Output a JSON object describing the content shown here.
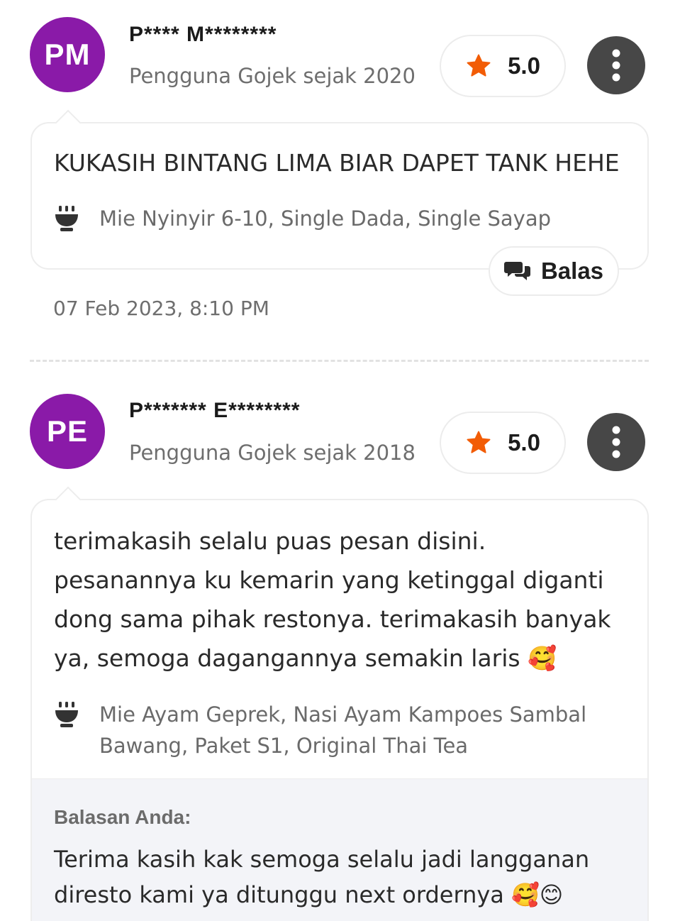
{
  "reviews": [
    {
      "initials": "PM",
      "name": "P**** M********",
      "since": "Pengguna Gojek sejak 2020",
      "rating": "5.0",
      "comment": "KUKASIH BINTANG LIMA BIAR DAPET TANK HEHE",
      "items": "Mie Nyinyir 6-10, Single Dada, Single Sayap",
      "reply_label": "Balas",
      "date": "07 Feb 2023, 8:10 PM"
    },
    {
      "initials": "PE",
      "name": "P******* E********",
      "since": "Pengguna Gojek sejak 2018",
      "rating": "5.0",
      "comment": "terimakasih selalu puas pesan disini. pesanannya ku kemarin yang ketinggal diganti dong sama pihak restonya. terimakasih banyak ya, semoga dagangannya semakin laris 🥰",
      "items": "Mie Ayam Geprek, Nasi Ayam Kampoes Sambal Bawang, Paket S1, Original Thai Tea",
      "reply_title": "Balasan Anda:",
      "reply_text": "Terima kasih kak semoga selalu jadi langganan diresto kami ya ditunggu next ordernya 🥰😊"
    }
  ],
  "colors": {
    "avatar": "#8a1aa8",
    "star": "#f25c05",
    "more_button": "#474747",
    "reply_box": "#f3f4f8"
  },
  "icons": {
    "rating": "star-icon",
    "more": "more-vertical-icon",
    "items": "food-bowl-icon",
    "reply": "chat-bubbles-icon"
  }
}
